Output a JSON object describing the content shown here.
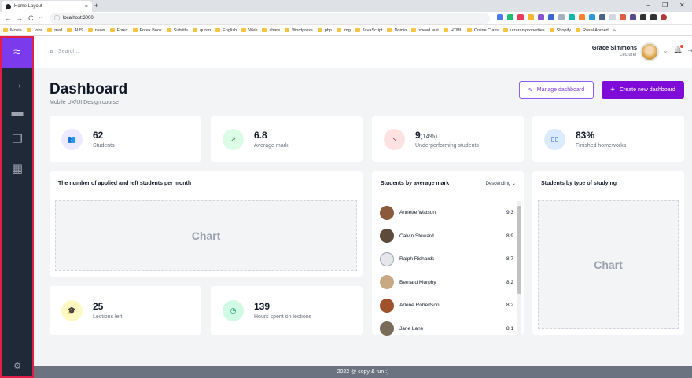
{
  "browser": {
    "tab_title": "Home Layout",
    "tab_close": "×",
    "new_tab": "+",
    "url": "localhost:3000",
    "nav_back": "←",
    "nav_forward": "→",
    "nav_reload": "C",
    "nav_home": "⌂",
    "info_icon": "ⓘ",
    "win_minimize": "−",
    "win_restore": "❐",
    "win_close": "✕",
    "bookmarks": [
      "Movie",
      "Jobs",
      "mail",
      "AUS",
      "news",
      "Forex",
      "Forex Book",
      "Subtitle",
      "quran",
      "English",
      "Web",
      "share",
      "Wordpress",
      "php",
      "img",
      "JavaScript",
      "Domin",
      "speed test",
      "HTML",
      "Online Class",
      "urraran properties",
      "Shopify",
      "Rasal Ahmed"
    ],
    "bookmarks_more": "»"
  },
  "sidebar": {
    "logo_glyph": "≈",
    "icons": [
      {
        "name": "arrow-right-icon",
        "glyph": "→"
      },
      {
        "name": "layers-icon",
        "glyph": "▬"
      },
      {
        "name": "copy-icon",
        "glyph": "❐"
      },
      {
        "name": "film-icon",
        "glyph": "▦"
      },
      {
        "name": "settings-icon",
        "glyph": "⚙"
      }
    ]
  },
  "topbar": {
    "search_placeholder": "Search...",
    "search_icon": "⌕",
    "user_name": "Grace Simmons",
    "user_role": "Lecturer",
    "chevron": "⌄",
    "bell_icon": "🔔",
    "logout_icon": "⇥"
  },
  "header": {
    "title": "Dashboard",
    "subtitle": "Mobile UX/UI Design course",
    "manage_label": "Manage dashboard",
    "manage_icon": "✎",
    "create_label": "Create new dashboard",
    "create_icon": "+"
  },
  "stats": [
    {
      "value": "62",
      "pct": "",
      "label": "Students",
      "icon": "👥",
      "color": "#ede9fe",
      "fg": "#7c3aed"
    },
    {
      "value": "6.8",
      "pct": "",
      "label": "Average mark",
      "icon": "↗",
      "color": "#dcfce7",
      "fg": "#16a34a"
    },
    {
      "value": "9",
      "pct": "(14%)",
      "label": "Underperforming students",
      "icon": "↘",
      "color": "#fee2e2",
      "fg": "#dc2626"
    },
    {
      "value": "83%",
      "pct": "",
      "label": "Finished homeworks",
      "icon": "▯▯",
      "color": "#dbeafe",
      "fg": "#2563eb"
    }
  ],
  "chart_card": {
    "title": "The number of applied and left students per month",
    "placeholder": "Chart"
  },
  "students_card": {
    "title": "Students by average mark",
    "sort_label": "Descending",
    "sort_icon": "⌄",
    "students": [
      {
        "name": "Annette Watson",
        "mark": "9.3"
      },
      {
        "name": "Calvin Steward",
        "mark": "8.9"
      },
      {
        "name": "Ralph Richards",
        "mark": "8.7"
      },
      {
        "name": "Bernard Murphy",
        "mark": "8.2"
      },
      {
        "name": "Arlene Robertson",
        "mark": "8.2"
      },
      {
        "name": "Jane Lane",
        "mark": "8.1"
      }
    ]
  },
  "type_card": {
    "title": "Students by type of studying",
    "placeholder": "Chart"
  },
  "bottom_stats": [
    {
      "value": "25",
      "label": "Lections left",
      "icon": "🎓",
      "color": "#fef9c3",
      "fg": "#ca8a04"
    },
    {
      "value": "139",
      "label": "Hours spent on lections",
      "icon": "◷",
      "color": "#d1fae5",
      "fg": "#059669"
    }
  ],
  "footer": {
    "text": "2022 @ copy & fun :)"
  }
}
